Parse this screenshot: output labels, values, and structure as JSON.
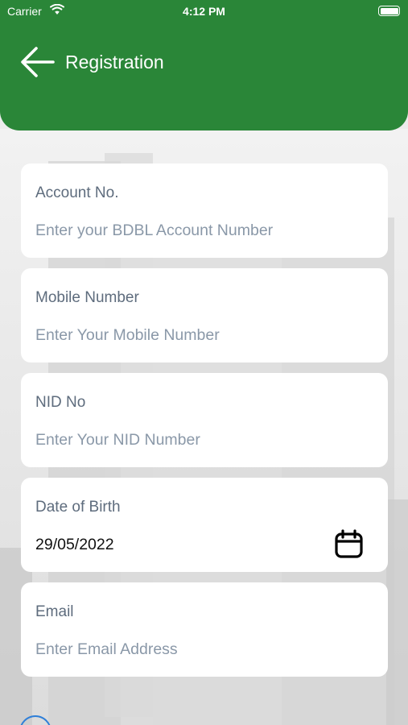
{
  "status_bar": {
    "carrier": "Carrier",
    "time": "4:12 PM"
  },
  "header": {
    "title": "Registration",
    "back_icon": "arrow-left-icon",
    "color": "#2a8638"
  },
  "form": {
    "account": {
      "label": "Account No.",
      "placeholder": "Enter your BDBL Account Number",
      "value": ""
    },
    "mobile": {
      "label": "Mobile Number",
      "placeholder": "Enter Your Mobile Number",
      "value": ""
    },
    "nid": {
      "label": "NID No",
      "placeholder": "Enter Your NID Number",
      "value": ""
    },
    "dob": {
      "label": "Date of Birth",
      "value": "29/05/2022",
      "icon": "calendar-icon"
    },
    "email": {
      "label": "Email",
      "placeholder": "Enter Email Address",
      "value": ""
    }
  }
}
